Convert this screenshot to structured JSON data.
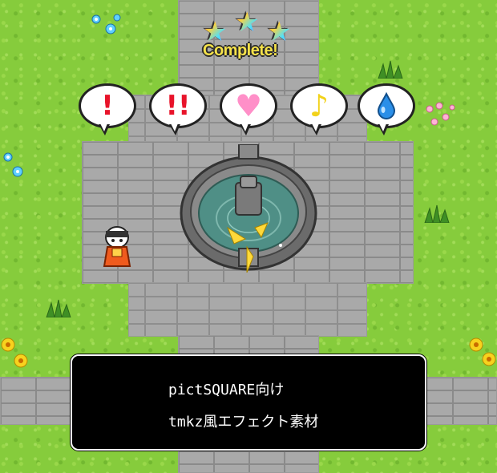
{
  "status": {
    "stars": 3,
    "label": "Complete!"
  },
  "emotes": [
    {
      "icon": "red-exclamation-icon",
      "glyph": "!",
      "color": "#e8132a"
    },
    {
      "icon": "red-double-exclamation-icon",
      "glyph": "!!",
      "color": "#e8132a"
    },
    {
      "icon": "pink-heart-icon",
      "glyph": "♥",
      "color": "#ff8fc8"
    },
    {
      "icon": "yellow-music-note-icon",
      "glyph": "♪",
      "color": "#f2d21a"
    },
    {
      "icon": "blue-water-drop-icon",
      "glyph": "💧",
      "color": "#2b8fe8"
    }
  ],
  "dialog": {
    "line1": "pictSQUARE向け",
    "line2": "tmkz風エフェクト素材"
  },
  "colors": {
    "grass": "#86cc3c",
    "stone": "#a9a9a9",
    "water": "#4f8f86",
    "dialog_bg": "#000000",
    "dialog_text": "#ffffff"
  }
}
